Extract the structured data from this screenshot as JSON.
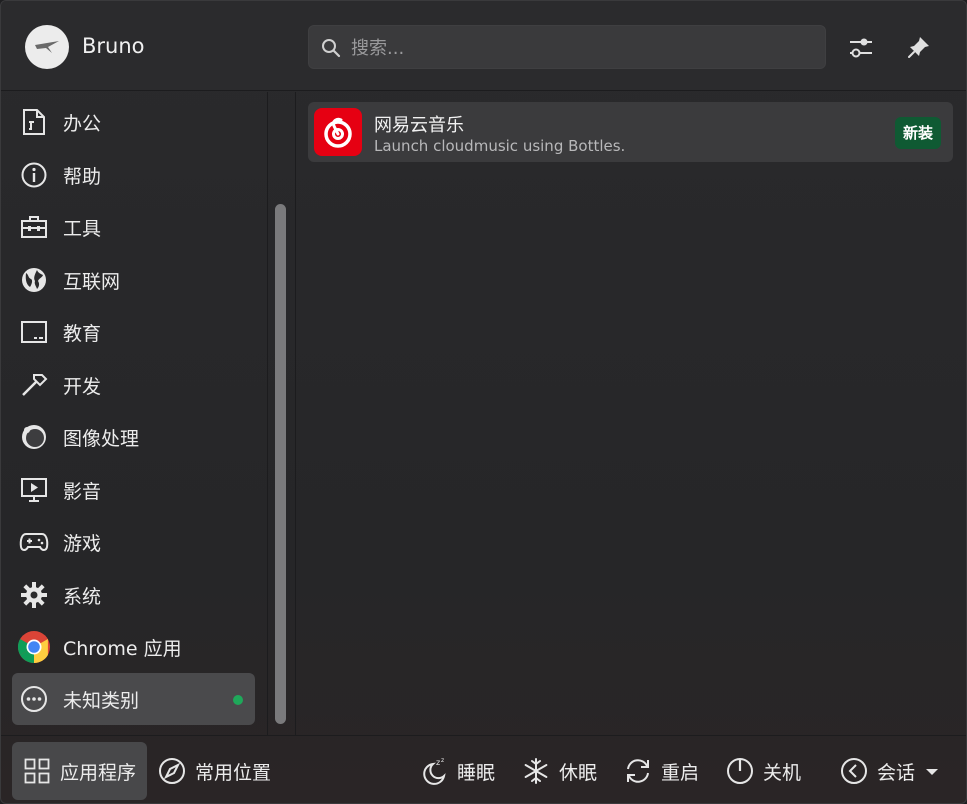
{
  "header": {
    "username": "Bruno",
    "search_placeholder": "搜索...",
    "buttons": [
      "configure-icon",
      "pin-icon"
    ]
  },
  "sidebar": {
    "categories": [
      {
        "label": "办公",
        "icon": "office-icon"
      },
      {
        "label": "帮助",
        "icon": "help-icon"
      },
      {
        "label": "工具",
        "icon": "toolbox-icon"
      },
      {
        "label": "互联网",
        "icon": "globe-icon"
      },
      {
        "label": "教育",
        "icon": "education-icon"
      },
      {
        "label": "开发",
        "icon": "hammer-icon"
      },
      {
        "label": "图像处理",
        "icon": "graphics-icon"
      },
      {
        "label": "影音",
        "icon": "multimedia-icon"
      },
      {
        "label": "游戏",
        "icon": "gamepad-icon"
      },
      {
        "label": "系统",
        "icon": "gear-icon"
      },
      {
        "label": "Chrome 应用",
        "icon": "chrome-icon"
      },
      {
        "label": "未知类别",
        "icon": "more-icon",
        "active": true,
        "new_indicator": true
      }
    ]
  },
  "apps": [
    {
      "name": "网易云音乐",
      "description": "Launch cloudmusic using Bottles.",
      "badge": "新装",
      "icon": "netease-cloudmusic-icon",
      "icon_color": "#e60012"
    }
  ],
  "footer": {
    "tabs": [
      {
        "label": "应用程序",
        "icon": "grid-icon",
        "active": true
      },
      {
        "label": "常用位置",
        "icon": "compass-icon"
      }
    ],
    "actions": [
      {
        "label": "睡眠",
        "icon": "sleep-icon"
      },
      {
        "label": "休眠",
        "icon": "hibernate-icon"
      },
      {
        "label": "重启",
        "icon": "restart-icon"
      },
      {
        "label": "关机",
        "icon": "power-icon"
      },
      {
        "label": "会话",
        "icon": "session-icon"
      }
    ]
  },
  "colors": {
    "accent_new": "#1fa85a",
    "badge_bg": "#0f5a33",
    "active_item": "#4a4a4c"
  }
}
